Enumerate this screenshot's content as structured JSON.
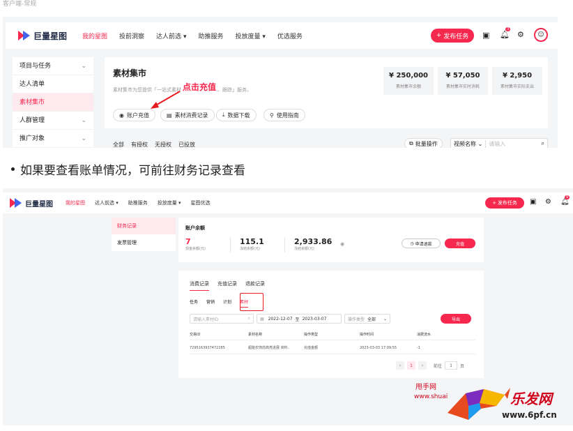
{
  "crumb": "客户端-常规",
  "top": {
    "brand": "巨量星图",
    "nav": [
      "我的星图",
      "投前洞察",
      "达人前选",
      "助推服务",
      "投放度量",
      "优选服务"
    ],
    "nav_dropdown": [
      false,
      false,
      true,
      false,
      true,
      false
    ],
    "publish": "发布任务",
    "badge": "3",
    "sidebar": [
      {
        "label": "项目与任务",
        "chevron": true
      },
      {
        "label": "达人清单",
        "chevron": false
      },
      {
        "label": "素材集市",
        "chevron": false,
        "active": true
      },
      {
        "label": "人群管理",
        "chevron": true
      },
      {
        "label": "推广对象",
        "chevron": true
      }
    ],
    "title": "素材集市",
    "desc": "素材集市为您提供「一站式素材",
    "desc_tail": "、跟踪」服务。",
    "annotation": "点击充值",
    "stats": [
      {
        "value": "¥ 250,000",
        "label": "素材集市余额"
      },
      {
        "value": "¥ 57,050",
        "label": "素材集市实时消耗"
      },
      {
        "value": "¥ 2,950",
        "label": "素材集市实际支出"
      }
    ],
    "buttons": [
      "账户充值",
      "素材消费记录",
      "数据下载",
      "使用指南"
    ],
    "tabs": [
      "全部",
      "有授权",
      "无授权",
      "已投放"
    ],
    "batch": "批量操作",
    "video_name": "视频名称",
    "search_placeholder": "请输入"
  },
  "bullet": "如果要查看账单情况，可前往财务记录查看",
  "bottom": {
    "brand": "巨量星图",
    "nav": [
      "我的星图",
      "达人前选",
      "助推服务",
      "投放度量",
      "星图优选"
    ],
    "nav_dropdown": [
      false,
      true,
      false,
      true,
      false
    ],
    "publish": "发布任务",
    "badge": "9",
    "sidebar": [
      "财务记录",
      "发票管理"
    ],
    "balance_title": "账户余额",
    "balances": [
      {
        "value": "7",
        "label": "现金余额(元)",
        "accent": true
      },
      {
        "value": "115.1",
        "label": "冻结余额(元)",
        "accent": false
      },
      {
        "value": "2,933.86",
        "label": "冻结余额(元)",
        "accent": false
      }
    ],
    "refund": "申请退款",
    "recharge": "充值",
    "tabs": [
      "消费记录",
      "充值记录",
      "退款记录"
    ],
    "subtabs": [
      "任务",
      "营销",
      "计划",
      "素材"
    ],
    "order_placeholder": "请输入素材ID",
    "date_from": "2022-12-07",
    "date_sep": "至",
    "date_to": "2023-03-07",
    "op_type_label": "操作类型",
    "op_type_value": "全部",
    "export": "导出",
    "columns": [
      "交易ID",
      "素材名称",
      "操作类型",
      "操作时间",
      "消费流水"
    ],
    "row": [
      "7295163937472285",
      "超能衣饰前高亮进展 资料..",
      "充值金额",
      "2023-03-03 17:09:55",
      "-1"
    ],
    "page": "1",
    "goto_label": "前往",
    "goto_value": "1",
    "goto_unit": "页"
  },
  "watermark": {
    "site1": "甩手网",
    "url1": "www.shuai",
    "brand2": "乐发网",
    "url2": "www.6pf.cn"
  },
  "colors": {
    "accent": "#f7284d",
    "accent_soft": "#fde9ee",
    "bg": "#f4f5f7"
  }
}
